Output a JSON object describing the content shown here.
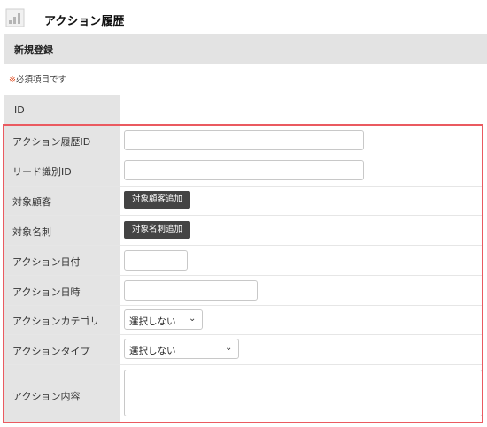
{
  "header": {
    "title": "アクション履歴",
    "app_icon": "chart-document-icon"
  },
  "section": {
    "title": "新規登録"
  },
  "required_note": {
    "mark": "※",
    "text": "必須項目です"
  },
  "form": {
    "id_label": "ID",
    "action_history_id_label": "アクション履歴ID",
    "action_history_id_value": "",
    "lead_id_label": "リード識別ID",
    "lead_id_value": "",
    "target_customer_label": "対象顧客",
    "target_customer_button": "対象顧客追加",
    "target_card_label": "対象名刺",
    "target_card_button": "対象名刺追加",
    "action_date_label": "アクション日付",
    "action_date_value": "",
    "action_time_label": "アクション日時",
    "action_time_value": "",
    "action_category_label": "アクションカテゴリ",
    "action_category_value": "選択しない",
    "action_type_label": "アクションタイプ",
    "action_type_value": "選択しない",
    "action_content_label": "アクション内容",
    "action_content_value": ""
  },
  "colors": {
    "highlight_border": "#ea5a60",
    "required_mark": "#e04a1e",
    "button_bg": "#444444"
  }
}
